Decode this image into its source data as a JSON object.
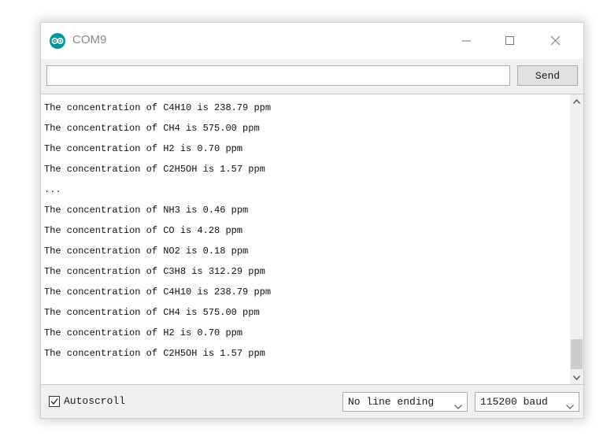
{
  "window": {
    "title": "COM9",
    "app_icon": "arduino-infinity-icon",
    "controls": [
      "minimize-icon",
      "maximize-icon",
      "close-icon"
    ]
  },
  "input": {
    "value": "",
    "placeholder": ""
  },
  "toolbar": {
    "send_label": "Send"
  },
  "output": {
    "lines": [
      "The concentration of C4H10 is 238.79 ppm",
      "The concentration of CH4 is 575.00 ppm",
      "The concentration of H2 is 0.70 ppm",
      "The concentration of C2H5OH is 1.57 ppm",
      "...",
      "The concentration of NH3 is 0.46 ppm",
      "The concentration of CO is 4.28 ppm",
      "The concentration of NO2 is 0.18 ppm",
      "The concentration of C3H8 is 312.29 ppm",
      "The concentration of C4H10 is 238.79 ppm",
      "The concentration of CH4 is 575.00 ppm",
      "The concentration of H2 is 0.70 ppm",
      "The concentration of C2H5OH is 1.57 ppm"
    ],
    "scroll_position": 1.0
  },
  "footer": {
    "autoscroll_label": "Autoscroll",
    "autoscroll_checked": true,
    "line_ending": "No line ending",
    "baud_rate": "115200 baud"
  },
  "colors": {
    "accent": "#00979c",
    "window_bg": "#f0f0f0",
    "output_bg": "#ffffff",
    "text": "#111111"
  }
}
